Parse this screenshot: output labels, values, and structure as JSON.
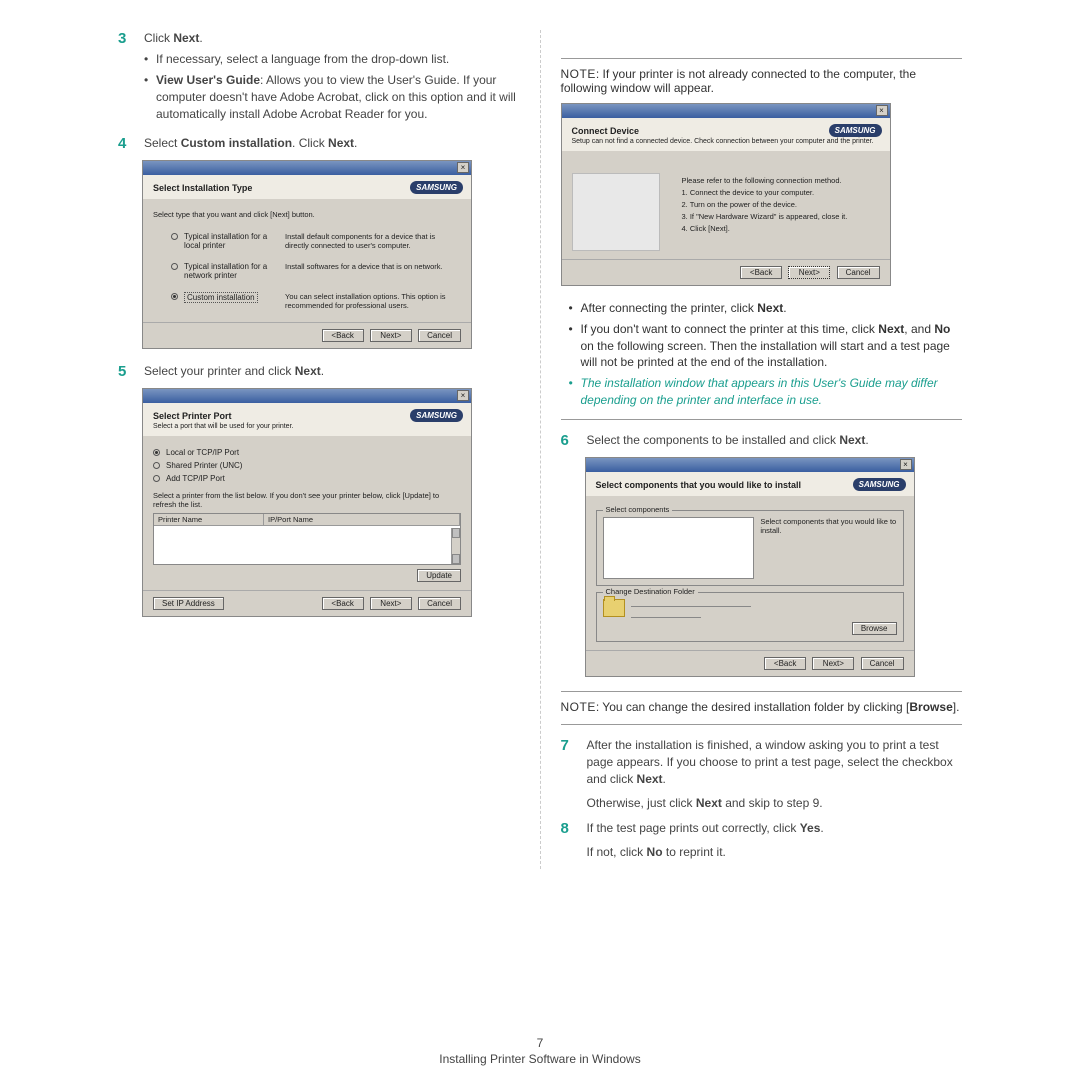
{
  "left": {
    "step3": {
      "num": "3",
      "title_a": "Click ",
      "title_b": "Next",
      "title_c": ".",
      "bul1": "If necessary, select a language from the drop-down list.",
      "bul2_a": "View User's Guide",
      "bul2_b": ": Allows you to view the User's Guide. If your computer doesn't have Adobe Acrobat, click on this option and it will automatically install Adobe Acrobat Reader for you."
    },
    "step4": {
      "num": "4",
      "txt_a": "Select ",
      "txt_b": "Custom installation",
      "txt_c": ". Click ",
      "txt_d": "Next",
      "txt_e": "."
    },
    "dlg4": {
      "title": "Select Installation Type",
      "logo": "SAMSUNG",
      "sub": "Select type that you want and click [Next] button.",
      "opt1_label": "Typical installation for a local printer",
      "opt1_desc": "Install default components for a device that is directly connected to user's computer.",
      "opt2_label": "Typical installation for a network printer",
      "opt2_desc": "Install softwares for a device that is on network.",
      "opt3_label": "Custom installation",
      "opt3_desc": "You can select installation options. This option is recommended for professional users.",
      "back": "<Back",
      "next": "Next>",
      "cancel": "Cancel"
    },
    "step5": {
      "num": "5",
      "txt_a": "Select your printer and click ",
      "txt_b": "Next",
      "txt_c": "."
    },
    "dlg5": {
      "title": "Select Printer Port",
      "sub": "Select a port that will be used for your printer.",
      "r1": "Local or TCP/IP Port",
      "r2": "Shared Printer (UNC)",
      "r3": "Add TCP/IP Port",
      "help": "Select a printer from the list below. If you don't see your printer below, click [Update] to refresh the list.",
      "col1": "Printer Name",
      "col2": "IP/Port Name",
      "update": "Update",
      "setip": "Set IP Address",
      "back": "<Back",
      "next": "Next>",
      "cancel": "Cancel",
      "logo": "SAMSUNG"
    }
  },
  "right": {
    "note1_a": "NOTE",
    "note1_b": ": If your printer is not already connected to the computer, the following window will appear.",
    "dlgc": {
      "title": "Connect Device",
      "sub": "Setup can not find a connected device. Check connection between your computer and the printer.",
      "logo": "SAMSUNG",
      "lead": "Please refer to the following connection method.",
      "i1": "1. Connect the device to your computer.",
      "i2": "2. Turn on the power of the device.",
      "i3": "3. If \"New Hardware Wizard\" is appeared, close it.",
      "i4": "4. Click [Next].",
      "back": "<Back",
      "next": "Next>",
      "cancel": "Cancel"
    },
    "after": {
      "b1_a": "After connecting the printer, click ",
      "b1_b": "Next",
      "b1_c": ".",
      "b2_a": "If you don't want to connect the printer at this time, click ",
      "b2_b": "Next",
      "b2_c": ", and ",
      "b2_d": "No",
      "b2_e": " on the following screen. Then the installation will start and a test page will not be printed at the end of the installation.",
      "b3": "The installation window that appears in this User's Guide may differ depending on the printer and interface in use."
    },
    "step6": {
      "num": "6",
      "txt_a": "Select the components to be installed and click ",
      "txt_b": "Next",
      "txt_c": "."
    },
    "dlg6": {
      "title": "Select components that you would like to install",
      "logo": "SAMSUNG",
      "fs1": "Select components",
      "right": "Select components that you would like to install.",
      "fs2": "Change Destination Folder",
      "browse": "Browse",
      "back": "<Back",
      "next": "Next>",
      "cancel": "Cancel"
    },
    "note2_a": "NOTE",
    "note2_b": ": You can change the desired installation folder by clicking [",
    "note2_c": "Browse",
    "note2_d": "].",
    "step7": {
      "num": "7",
      "line1_a": "After the installation is finished, a window asking you to print a test page appears. If you choose to print a test page, select the checkbox and click ",
      "line1_b": "Next",
      "line1_c": ".",
      "line2_a": "Otherwise, just click ",
      "line2_b": "Next",
      "line2_c": " and skip to step 9."
    },
    "step8": {
      "num": "8",
      "line1_a": "If the test page prints out correctly, click ",
      "line1_b": "Yes",
      "line1_c": ".",
      "line2_a": "If not, click ",
      "line2_b": "No",
      "line2_c": " to reprint it."
    }
  },
  "footer": {
    "page": "7",
    "chapter": "Installing Printer Software in Windows"
  }
}
